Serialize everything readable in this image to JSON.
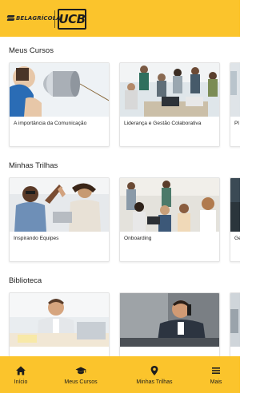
{
  "header": {
    "brand_primary": "BELAGRÍCOLA.",
    "brand_secondary": "UCB",
    "bar_color": "#fbc42c"
  },
  "sections": [
    {
      "title": "Meus Cursos",
      "cards": [
        {
          "label": "A importância da Comunicação",
          "image": "tin-can-telephone-photo"
        },
        {
          "label": "Liderança e Gestão Colaborativa",
          "image": "team-meeting-photo"
        },
        {
          "label": "Pl",
          "image": "partial-photo"
        }
      ]
    },
    {
      "title": "Minhas Trilhas",
      "cards": [
        {
          "label": "Inspirando Equipes",
          "image": "high-five-photo"
        },
        {
          "label": "Onboarding",
          "image": "office-team-photo"
        },
        {
          "label": "Ge",
          "image": "partial-photo"
        }
      ]
    },
    {
      "title": "Biblioteca",
      "cards": [
        {
          "label": "",
          "image": "businessman-desk-photo"
        },
        {
          "label": "",
          "image": "phone-call-photo"
        },
        {
          "label": "",
          "image": "partial-photo"
        }
      ]
    }
  ],
  "bottom_nav": [
    {
      "label": "Início",
      "icon": "home-icon"
    },
    {
      "label": "Meus Cursos",
      "icon": "graduation-cap-icon"
    },
    {
      "label": "Minhas Trilhas",
      "icon": "map-pin-icon"
    },
    {
      "label": "Mais",
      "icon": "menu-icon"
    }
  ]
}
